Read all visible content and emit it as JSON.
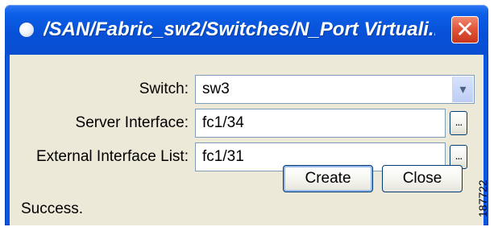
{
  "window": {
    "title": "/SAN/Fabric_sw2/Switches/N_Port Virtuali...",
    "close_glyph": "✕",
    "accent_color": "#0a58e2",
    "close_color": "#e1573b"
  },
  "form": {
    "switch": {
      "label": "Switch:",
      "value": "sw3",
      "dropdown_icon": "chevron-down-icon"
    },
    "server_interface": {
      "label": "Server Interface:",
      "value": "fc1/34",
      "browse_label": "..."
    },
    "external_interface_list": {
      "label": "External Interface List:",
      "value": "fc1/31",
      "browse_label": "..."
    }
  },
  "buttons": {
    "create_label": "Create",
    "close_label": "Close"
  },
  "status": {
    "text": "Success."
  },
  "figure": {
    "id": "187722"
  }
}
